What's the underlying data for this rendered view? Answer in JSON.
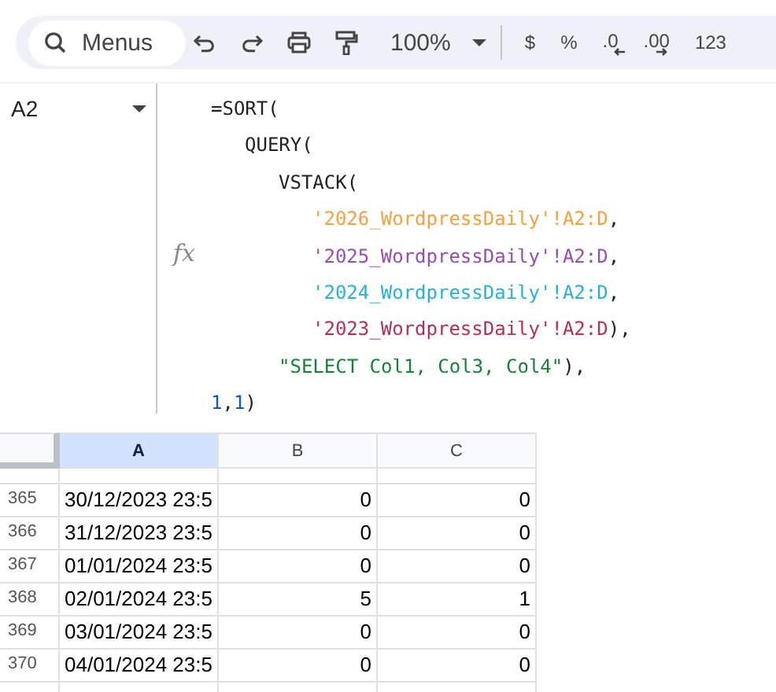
{
  "toolbar": {
    "search": {
      "placeholder": "Menus"
    },
    "zoom": "100%",
    "format_buttons": [
      {
        "text": "$",
        "kind": "plain"
      },
      {
        "text": "%",
        "kind": "plain"
      },
      {
        "text": ".0",
        "kind": "decrease"
      },
      {
        "text": ".00",
        "kind": "increase"
      },
      {
        "text": "123",
        "kind": "plain"
      }
    ]
  },
  "formula_bar": {
    "name_box": "A2",
    "fx": "fx",
    "lines": [
      {
        "segments": [
          {
            "text": "=SORT(",
            "color": "#202124"
          }
        ],
        "children": [
          {
            "segments": [
              {
                "text": "QUERY(",
                "color": "#202124"
              }
            ],
            "children": [
              {
                "segments": [
                  {
                    "text": "VSTACK(",
                    "color": "#202124"
                  }
                ],
                "children": [
                  {
                    "segments": [
                      {
                        "text": "'2026_WordpressDaily'!A2:D",
                        "color": "#f6a040"
                      },
                      {
                        "text": ",",
                        "color": "#202124"
                      }
                    ]
                  },
                  {
                    "segments": [
                      {
                        "text": "'2025_WordpressDaily'!A2:D",
                        "color": "#9a4db0"
                      },
                      {
                        "text": ",",
                        "color": "#202124"
                      }
                    ]
                  },
                  {
                    "segments": [
                      {
                        "text": "'2024_WordpressDaily'!A2:D",
                        "color": "#28b0d8"
                      },
                      {
                        "text": ",",
                        "color": "#202124"
                      }
                    ]
                  },
                  {
                    "segments": [
                      {
                        "text": "'2023_WordpressDaily'!A2:D",
                        "color": "#b0305c"
                      },
                      {
                        "text": "),",
                        "color": "#202124"
                      }
                    ]
                  }
                ]
              },
              {
                "segments": [
                  {
                    "text": "\"SELECT Col1, Col3, Col4\"",
                    "color": "#188038"
                  },
                  {
                    "text": "),",
                    "color": "#202124"
                  }
                ]
              }
            ]
          }
        ]
      },
      {
        "segments": [
          {
            "text": "1",
            "color": "#1155cc"
          },
          {
            "text": ",",
            "color": "#202124"
          },
          {
            "text": "1",
            "color": "#1155cc"
          },
          {
            "text": ")",
            "color": "#202124"
          }
        ]
      }
    ]
  },
  "grid": {
    "columns": [
      {
        "label": "A",
        "selected": true
      },
      {
        "label": "B",
        "selected": false
      },
      {
        "label": "C",
        "selected": false
      }
    ],
    "rows": [
      {
        "header": "365",
        "cells": [
          "30/12/2023 23:5",
          "0",
          "0"
        ]
      },
      {
        "header": "366",
        "cells": [
          "31/12/2023 23:5",
          "0",
          "0"
        ]
      },
      {
        "header": "367",
        "cells": [
          "01/01/2024 23:5",
          "0",
          "0"
        ]
      },
      {
        "header": "368",
        "cells": [
          "02/01/2024 23:5",
          "5",
          "1"
        ]
      },
      {
        "header": "369",
        "cells": [
          "03/01/2024 23:5",
          "0",
          "0"
        ]
      },
      {
        "header": "370",
        "cells": [
          "04/01/2024 23:5",
          "0",
          "0"
        ]
      }
    ]
  }
}
